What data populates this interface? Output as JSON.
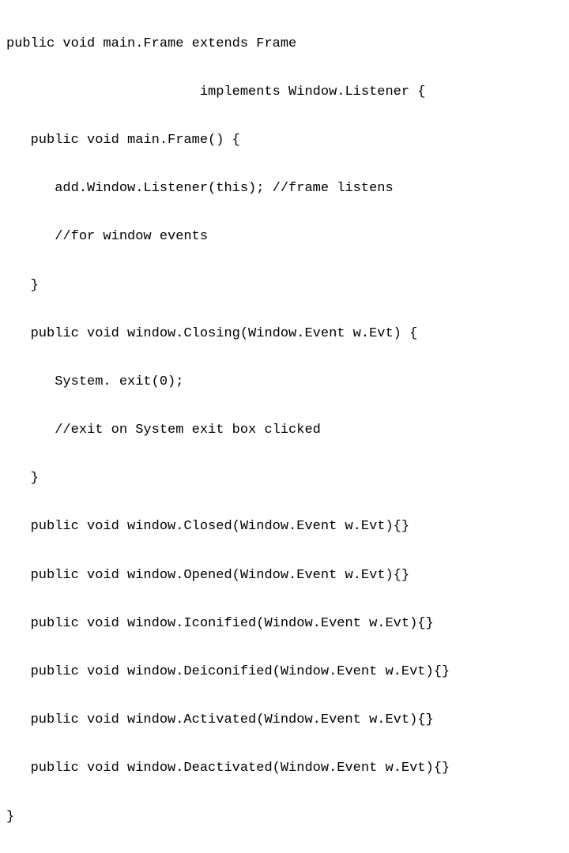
{
  "code": {
    "lines": [
      "public void main.Frame extends Frame",
      "                        implements Window.Listener {",
      "   public void main.Frame() {",
      "      add.Window.Listener(this); //frame listens",
      "      //for window events",
      "   }",
      "   public void window.Closing(Window.Event w.Evt) {",
      "      System. exit(0);",
      "      //exit on System exit box clicked",
      "   }",
      "   public void window.Closed(Window.Event w.Evt){}",
      "   public void window.Opened(Window.Event w.Evt){}",
      "   public void window.Iconified(Window.Event w.Evt){}",
      "   public void window.Deiconified(Window.Event w.Evt){}",
      "   public void window.Activated(Window.Event w.Evt){}",
      "   public void window.Deactivated(Window.Event w.Evt){}",
      "}"
    ]
  }
}
